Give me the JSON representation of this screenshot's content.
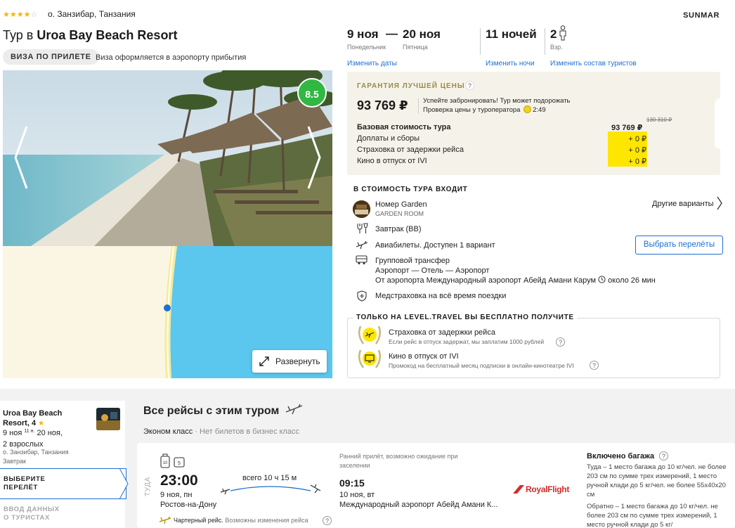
{
  "header": {
    "stars": "★★★★",
    "star_off": "☆",
    "location": "о. Занзибар, Танзания",
    "brand": "SUNMAR",
    "title_prefix": "Тур в ",
    "hotel_name": "Uroa Bay Beach Resort",
    "visa_badge": "ВИЗА ПО ПРИЛЕТЕ",
    "visa_note": "Виза оформляется в аэропорту прибытия"
  },
  "gallery": {
    "rating": "8.5",
    "expand_label": "Развернуть"
  },
  "dates": {
    "from": "9 ноя",
    "from_day": "Понедельник",
    "separator": "—",
    "to": "20 ноя",
    "to_day": "Пятница",
    "nights": "11 ночей",
    "adults": "2",
    "adults_label": "Взр.",
    "change_dates": "Изменить даты",
    "change_nights": "Изменить ночи",
    "change_tourists": "Изменить состав туристов"
  },
  "price": {
    "guarantee": "ГАРАНТИЯ ЛУЧШЕЙ ЦЕНЫ",
    "help": "?",
    "total": "93 769 ₽",
    "hurry_line1": "Успейте забронировать! Тур может подорожать",
    "hurry_line2": "Проверка цены у туроператора",
    "timer": "2:49",
    "old_price": "130 310 ₽",
    "rows": [
      {
        "label": "Базовая стоимость тура",
        "value": "93 769 ₽"
      },
      {
        "label": "Доплаты и сборы",
        "value": "+ 0 ₽"
      },
      {
        "label": "Страховка от задержки рейса",
        "value": "+ 0 ₽"
      },
      {
        "label": "Кино в отпуск от IVI",
        "value": "+ 0 ₽"
      }
    ]
  },
  "included": {
    "heading": "В СТОИМОСТЬ ТУРА ВХОДИТ",
    "room": "Номер Garden",
    "room_sub": "GARDEN ROOM",
    "other_variants": "Другие варианты",
    "meal": "Завтрак (BB)",
    "flights": "Авиабилеты. Доступен 1 вариант",
    "select_flights": "Выбрать перелёты",
    "transfer": "Групповой трансфер",
    "transfer_route": "Аэропорт — Отель — Аэропорт",
    "transfer_from": "От аэропорта Международный аэропорт Абейд Амани Карум",
    "transfer_time": "около 26 мин",
    "insurance": "Медстраховка на всё время поездки"
  },
  "bonus": {
    "heading": "ТОЛЬКО НА LEVEL.TRAVEL ВЫ БЕСПЛАТНО ПОЛУЧИТЕ",
    "items": [
      {
        "title": "Страховка от задержки рейса",
        "sub": "Если рейс в отпуск задержат, мы заплатим 1000 рублей"
      },
      {
        "title": "Кино в отпуск от IVI",
        "sub": "Промокод на бесплатный месяц подписки в онлайн-кинотеатре IVI"
      }
    ]
  },
  "sidebar": {
    "hotel_line1": "Uroa Bay Beach",
    "hotel_line2": "Resort, 4",
    "star": "★",
    "date_from": "9 ноя",
    "nights_small": "11 н.",
    "date_to": "20 ноя,",
    "adults": "2 взрослых",
    "location": "о. Занзибар, Танзания",
    "meal": "Завтрак",
    "step_active_1": "ВЫБЕРИТЕ",
    "step_active_2": "ПЕРЕЛЁТ",
    "step_next_1": "ВВОД ДАННЫХ",
    "step_next_2": "О ТУРИСТАХ"
  },
  "flights": {
    "title": "Все рейсы с этим туром",
    "class_main": "Эконом класс",
    "class_note": " · Нет билетов в бизнес класс",
    "direction": "ТУДА",
    "bag_icon_1": "10",
    "bag_icon_2": "5",
    "dep_time": "23:00",
    "dep_date": "9 ноя, пн",
    "dep_city": "Ростов-на-Дону",
    "total_time": "всего 10 ч 15 м",
    "arr_note": "Ранний прилёт, возможно ожидание при заселении",
    "arr_time": "09:15",
    "arr_date": "10 ноя, вт",
    "arr_airport": "Международный аэропорт Абейд Амани К...",
    "airline": "RoyalFlight",
    "charter": "Чартерный рейс.",
    "charter_note": " Возможны изменения рейса",
    "baggage_title": "Включено багажа",
    "baggage_to": "Туда – 1 место багажа до 10 кг/чел. не более 203 см по сумме трех измерений, 1 место ручной клади до 5 кг/чел. не более 55х40х20 см",
    "baggage_back": "Обратно – 1 место багажа до 10 кг/чел. не более 203 см по сумме трех измерений, 1 место ручной клади до 5 кг/"
  }
}
